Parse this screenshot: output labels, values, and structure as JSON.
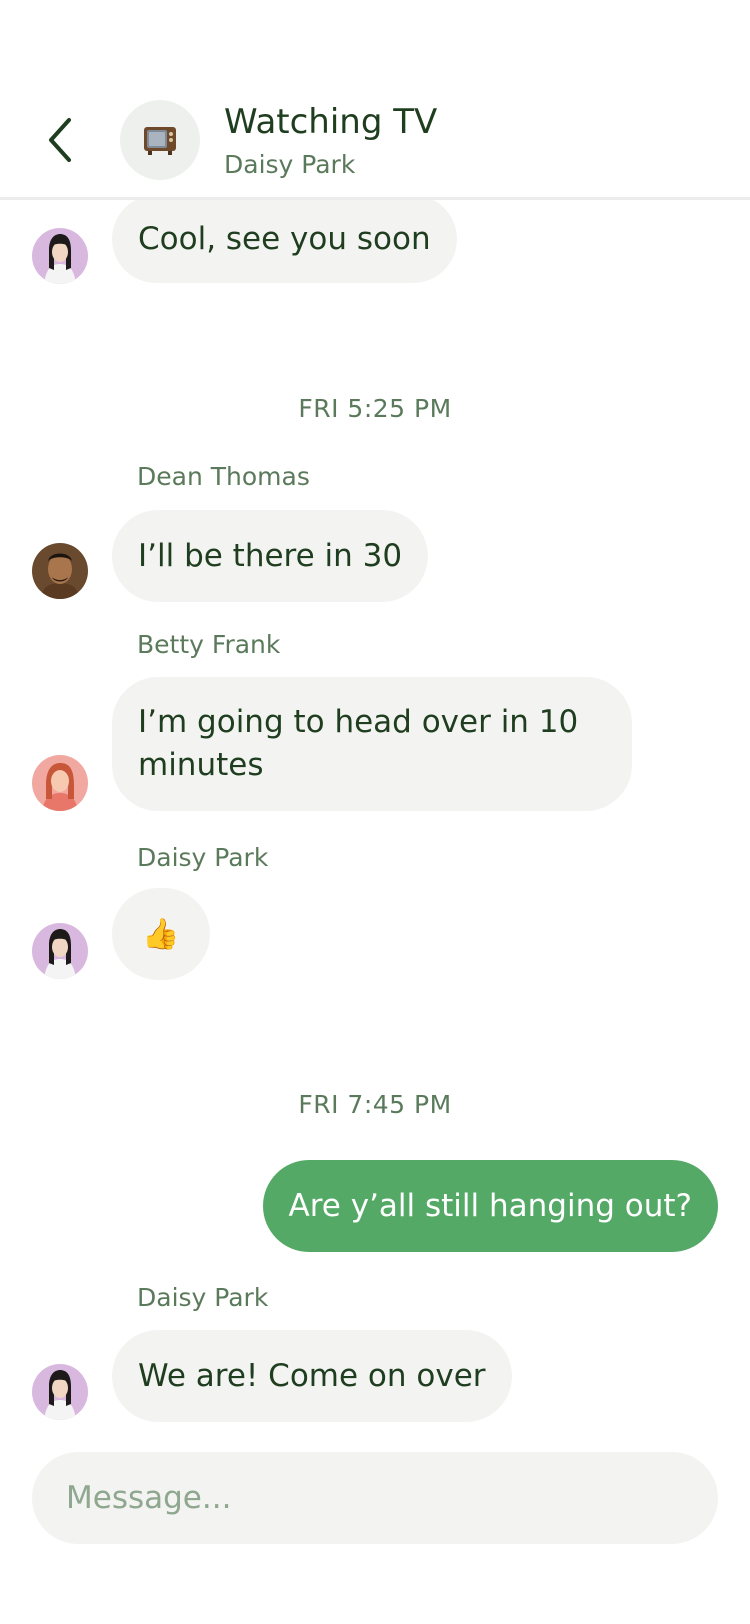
{
  "header": {
    "title": "Watching TV",
    "subtitle": "Daisy Park",
    "chat_icon": "tv-emoji"
  },
  "messages": [
    {
      "sender": "Daisy Park",
      "text": "Cool, see you soon",
      "avatar": "daisy"
    },
    {
      "timestamp": "FRI 5:25 PM"
    },
    {
      "sender": "Dean Thomas",
      "text": "I’ll be there in 30",
      "avatar": "dean"
    },
    {
      "sender": "Betty Frank",
      "text": "I’m going to head over in 10 minutes",
      "avatar": "betty"
    },
    {
      "sender": "Daisy Park",
      "text": "👍",
      "avatar": "daisy"
    },
    {
      "timestamp": "FRI 7:45 PM"
    },
    {
      "sender": "me",
      "text": "Are y’all still hanging out?"
    },
    {
      "sender": "Daisy Park",
      "text": "We are! Come on over",
      "avatar": "daisy"
    }
  ],
  "composer": {
    "placeholder": "Message..."
  },
  "colors": {
    "accent_green": "#55a966",
    "text_dark_green": "#1f3d1f",
    "muted_green": "#5b7a5b",
    "bubble_gray": "#f3f4f2"
  }
}
